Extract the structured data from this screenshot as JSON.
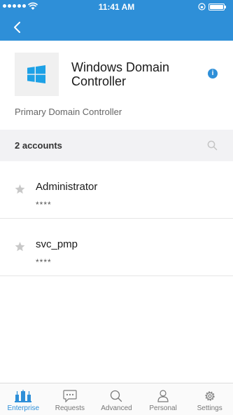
{
  "status_bar": {
    "time": "11:41 AM"
  },
  "resource": {
    "name": "Windows Domain Controller",
    "description": "Primary Domain Controller",
    "logo_icon": "windows-logo-icon"
  },
  "accounts_header": {
    "count_label": "2 accounts"
  },
  "accounts": [
    {
      "name": "Administrator",
      "password": "****"
    },
    {
      "name": "svc_pmp",
      "password": "****"
    }
  ],
  "tabs": [
    {
      "label": "Enterprise",
      "icon": "enterprise-icon",
      "active": true
    },
    {
      "label": "Requests",
      "icon": "requests-icon",
      "active": false
    },
    {
      "label": "Advanced",
      "icon": "search-icon",
      "active": false
    },
    {
      "label": "Personal",
      "icon": "person-icon",
      "active": false
    },
    {
      "label": "Settings",
      "icon": "gear-icon",
      "active": false
    }
  ],
  "colors": {
    "accent": "#2e8fd8",
    "windows_logo": "#1da1e6"
  }
}
